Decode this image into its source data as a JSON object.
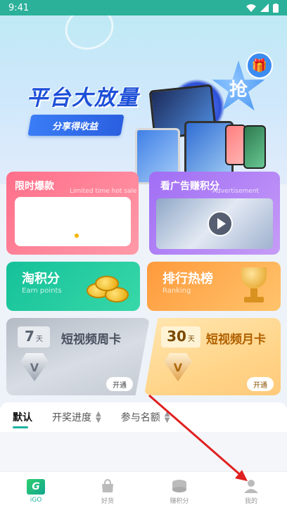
{
  "status_bar": {
    "time": "9:41"
  },
  "banner": {
    "title": "平台大放量",
    "button_label": "分享得收益",
    "badge_label": "抢"
  },
  "cards": {
    "flash_sale": {
      "title": "限时爆款",
      "subtitle": "Limited time hot sale"
    },
    "watch_ads": {
      "title": "看广告赚积分",
      "subtitle": "Advertisement"
    },
    "earn_points": {
      "title": "淘积分",
      "subtitle": "Earn points"
    },
    "ranking": {
      "title": "排行热榜",
      "subtitle": "Ranking"
    },
    "weekly_card": {
      "days": "7",
      "days_unit": "天",
      "title": "短视频周卡",
      "badge": "V",
      "button_label": "开通"
    },
    "monthly_card": {
      "days": "30",
      "days_unit": "天",
      "title": "短视频月卡",
      "badge": "V",
      "button_label": "开通"
    }
  },
  "filter_tabs": [
    {
      "label": "默认",
      "active": true
    },
    {
      "label": "开奖进度",
      "sortable": true
    },
    {
      "label": "参与名额",
      "sortable": true
    }
  ],
  "tabbar": [
    {
      "label": "iGO",
      "icon": "igo-logo-icon",
      "active": true
    },
    {
      "label": "好货",
      "icon": "shopping-bag-icon"
    },
    {
      "label": "赚积分",
      "icon": "coin-stack-icon"
    },
    {
      "label": "我的",
      "icon": "person-icon"
    }
  ],
  "colors": {
    "accent": "#1db1a0",
    "status_bar": "#2bb09a",
    "arrow": "#e02020"
  }
}
